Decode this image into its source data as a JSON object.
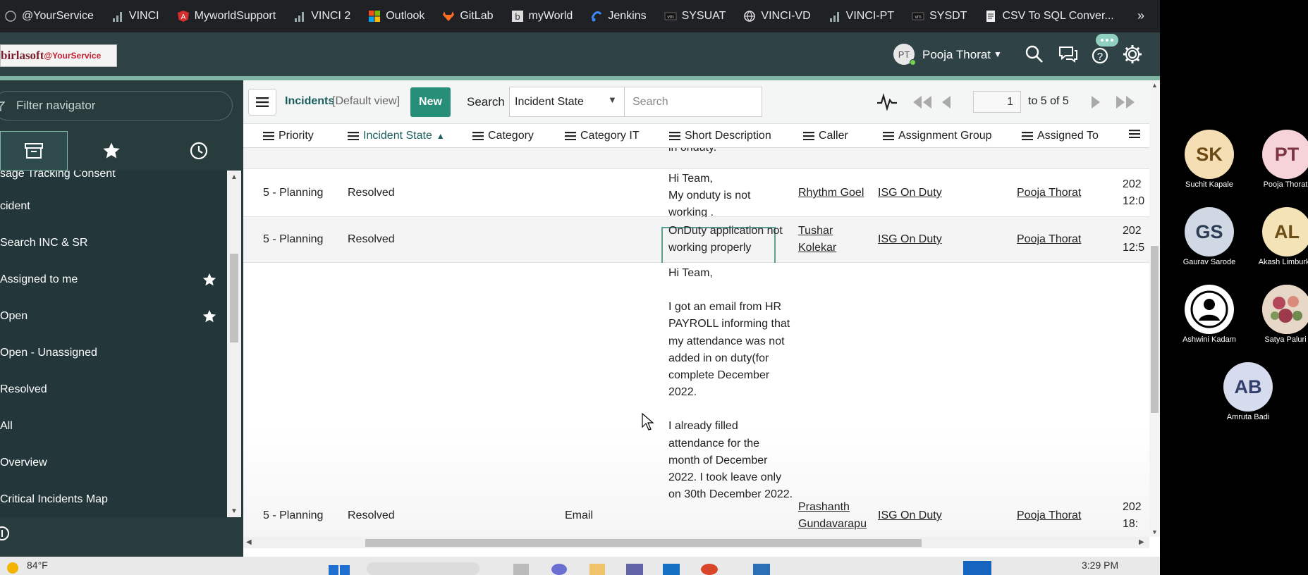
{
  "bookmarks": {
    "items": [
      {
        "label": "@YourService",
        "icon": "globe-icon"
      },
      {
        "label": "VINCI",
        "icon": "bar-chart-icon"
      },
      {
        "label": "MyworldSupport",
        "icon": "angular-icon"
      },
      {
        "label": "VINCI 2",
        "icon": "bar-chart-icon"
      },
      {
        "label": "Outlook",
        "icon": "microsoft-icon"
      },
      {
        "label": "GitLab",
        "icon": "gitlab-icon"
      },
      {
        "label": "myWorld",
        "icon": "b-icon"
      },
      {
        "label": "Jenkins",
        "icon": "jenkins-icon"
      },
      {
        "label": "SYSUAT",
        "icon": "vm-icon"
      },
      {
        "label": "VINCI-VD",
        "icon": "globe-icon"
      },
      {
        "label": "VINCI-PT",
        "icon": "bar-chart-icon"
      },
      {
        "label": "SYSDT",
        "icon": "vm-icon"
      },
      {
        "label": "CSV To SQL Conver...",
        "icon": "document-icon"
      }
    ],
    "more": "»"
  },
  "header": {
    "logo_text": "birlasoft",
    "logo_suffix": "@YourService",
    "user_initials": "PT",
    "user_name": "Pooja Thorat"
  },
  "nav": {
    "filter_placeholder": "Filter navigator",
    "items": [
      {
        "label": "sage Tracking Consent",
        "star": false
      },
      {
        "label": "cident",
        "star": false
      },
      {
        "label": "Search INC & SR",
        "star": false
      },
      {
        "label": "Assigned to me",
        "star": true
      },
      {
        "label": "Open",
        "star": true
      },
      {
        "label": "Open - Unassigned",
        "star": false
      },
      {
        "label": "Resolved",
        "star": false
      },
      {
        "label": "All",
        "star": false
      },
      {
        "label": "Overview",
        "star": false
      },
      {
        "label": "Critical Incidents Map",
        "star": false
      }
    ]
  },
  "list": {
    "title": "Incidents",
    "view": "[Default view]",
    "new_label": "New",
    "search_label": "Search",
    "search_field": "Incident State",
    "search_placeholder": "Search",
    "page_number": "1",
    "page_range": "to 5 of 5",
    "columns": [
      "Priority",
      "Incident State",
      "Category",
      "Category IT",
      "Short Description",
      "Caller",
      "Assignment Group",
      "Assigned To"
    ],
    "top_fragment": "in onduty.",
    "rows": [
      {
        "priority": "5 - Planning",
        "state": "Resolved",
        "category": "",
        "category_it": "",
        "desc": [
          "Hi Team,",
          "My onduty is not",
          "working ."
        ],
        "caller": [
          "Rhythm Goel"
        ],
        "group": "ISG On Duty",
        "assigned": "Pooja Thorat",
        "date": [
          "202",
          "12:0"
        ]
      },
      {
        "priority": "5 - Planning",
        "state": "Resolved",
        "category": "",
        "category_it": "",
        "desc": [
          "OnDuty application not",
          "working properly"
        ],
        "caller": [
          "Tushar",
          "Kolekar"
        ],
        "group": "ISG On Duty",
        "assigned": "Pooja Thorat",
        "date": [
          "202",
          "12:5"
        ]
      },
      {
        "priority": "5 - Planning",
        "state": "Resolved",
        "category": "",
        "category_it": "Email",
        "desc": [
          "Hi Team,",
          "",
          "I got an email from HR",
          "PAYROLL informing that",
          "my attendance was not",
          "added in on duty(for",
          "complete December",
          "2022.",
          "",
          "I already filled",
          "attendance for the",
          "month of December",
          "2022. I took leave only",
          "on 30th December 2022."
        ],
        "caller": [
          "Prashanth",
          "Gundavarapu"
        ],
        "group": "ISG On Duty",
        "assigned": "Pooja Thorat",
        "date": [
          "202",
          "18:"
        ]
      }
    ]
  },
  "taskbar": {
    "weather": "84°F",
    "time": "3:29 PM"
  },
  "participants": [
    {
      "initials": "SK",
      "name": "Suchit Kapale",
      "color": "#f5deb3",
      "text": "#6b4a16"
    },
    {
      "initials": "PT",
      "name": "Pooja Thorat",
      "color": "#f6d3d8",
      "text": "#7b3340"
    },
    {
      "initials": "GS",
      "name": "Gaurav Sarode",
      "color": "#cfd8e3",
      "text": "#2c3e55"
    },
    {
      "initials": "AL",
      "name": "Akash Limburkar",
      "color": "#f5e3b8",
      "text": "#6b4f16"
    },
    {
      "initials": "",
      "name": "Ashwini Kadam",
      "color": "#ffffff",
      "text": "#000000"
    },
    {
      "initials": "",
      "name": "Satya Paluri",
      "color": "#e8d6c8",
      "text": "#000000"
    },
    {
      "initials": "AB",
      "name": "Amruta Badi",
      "color": "#d6dbee",
      "text": "#33406b"
    }
  ],
  "colors": {
    "header_bg": "#2f4346",
    "nav_bg": "#283c3e",
    "accent": "#278e77"
  }
}
